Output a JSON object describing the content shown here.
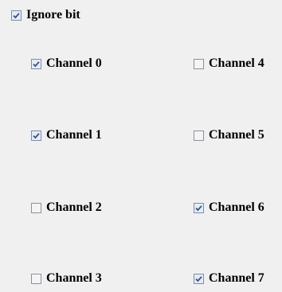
{
  "ignore_bit": {
    "label": "Ignore bit",
    "checked": true
  },
  "channels": [
    {
      "label": "Channel 0",
      "checked": true
    },
    {
      "label": "Channel 1",
      "checked": true
    },
    {
      "label": "Channel 2",
      "checked": false
    },
    {
      "label": "Channel 3",
      "checked": false
    },
    {
      "label": "Channel 4",
      "checked": false
    },
    {
      "label": "Channel 5",
      "checked": false
    },
    {
      "label": "Channel 6",
      "checked": true
    },
    {
      "label": "Channel 7",
      "checked": true
    }
  ]
}
